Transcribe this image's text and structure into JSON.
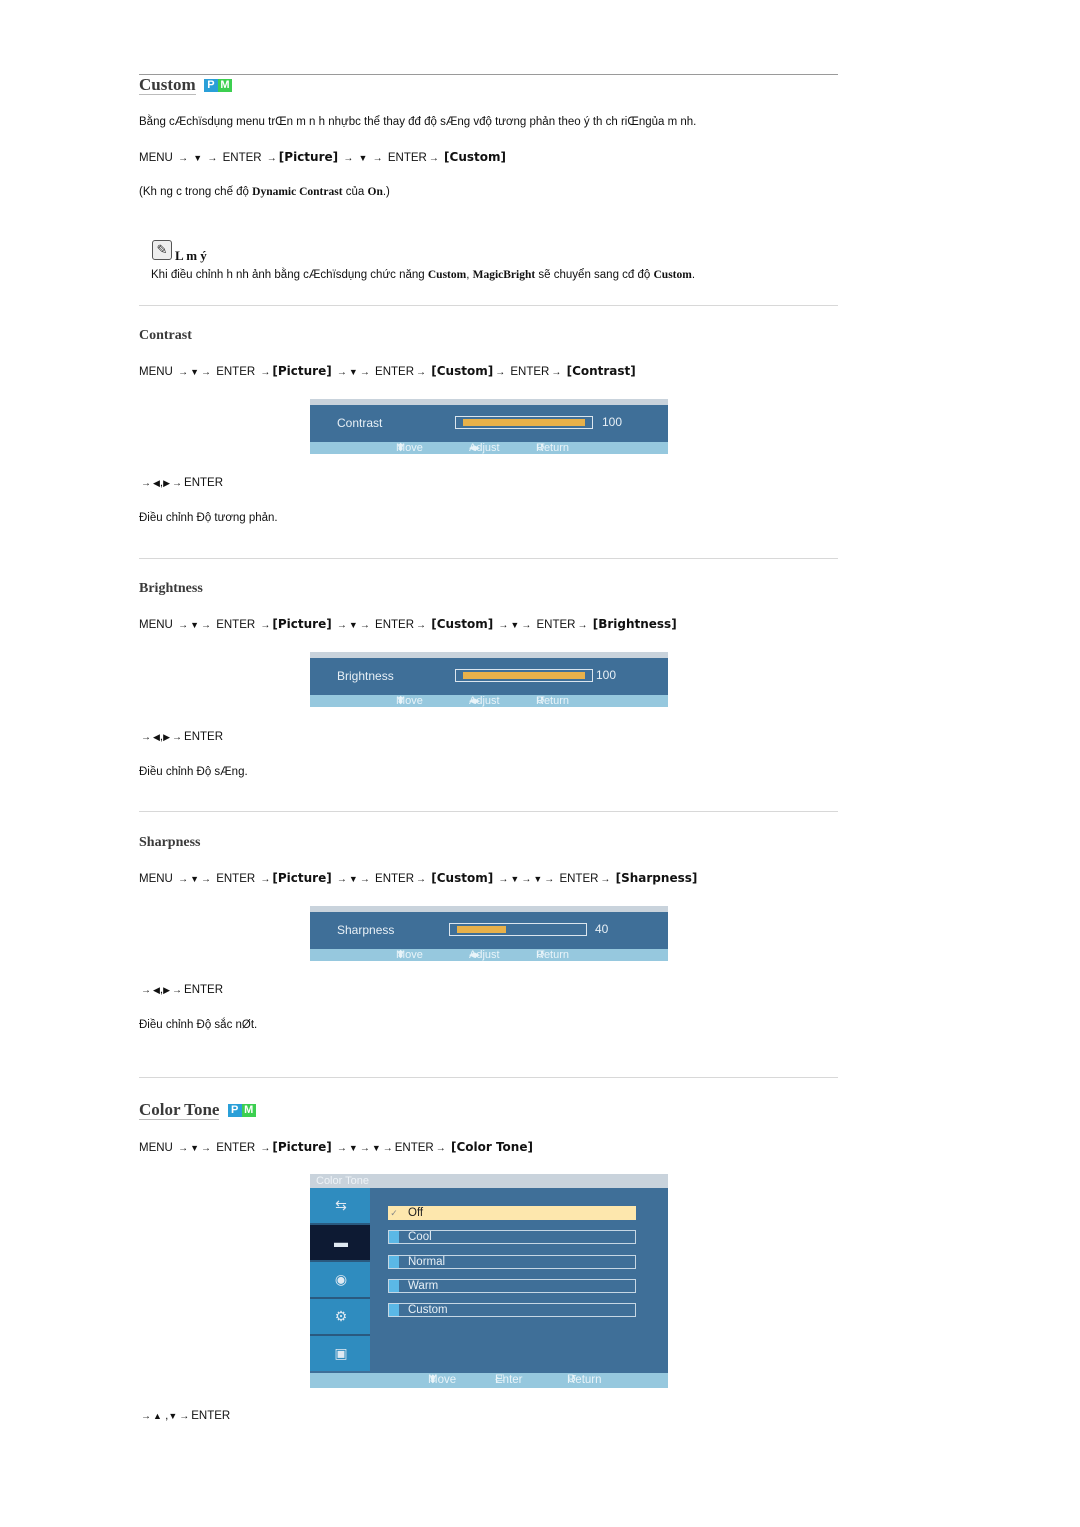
{
  "custom": {
    "title": "Custom",
    "badge_p": "P",
    "badge_m": "M",
    "desc": "Bằng cÆchïsdụng menu trŒn m n h nhựbc  thể thay đđ độ sÆng vđộ tương phản theo ý th ch riŒngủa m nh.",
    "path": {
      "menu": "MENU",
      "enter": "ENTER",
      "picture": "[Picture]",
      "custom": "[Custom]"
    },
    "note_line_prefix": "(Kh ng c  trong chế độ ",
    "note_line_bold1": "Dynamic Contrast",
    "note_line_mid": " của ",
    "note_line_bold2": "On",
    "note_line_suffix": ".)",
    "memo_title": "L m ý",
    "memo_prefix": "Khi điều chỉnh h nh ảnh bằng cÆchïsdụng chức năng ",
    "memo_bold1": "Custom",
    "memo_sep": ", ",
    "memo_bold2": "MagicBright",
    "memo_mid": " sẽ chuyển sang cđ độ ",
    "memo_bold3": "Custom",
    "memo_suffix": "."
  },
  "symbols": {
    "arrow": "→",
    "down": "▼",
    "up": "▲",
    "left": "◀",
    "right": "▶",
    "updown": "⬍",
    "leftright": "◂▸",
    "return": "↺",
    "enter_icon": "⏎",
    "check": "✓"
  },
  "contrast": {
    "title": "Contrast",
    "target": "[Contrast]",
    "osd_label": "Contrast",
    "value_text": "100",
    "value": 100,
    "adjust_line": "ENTER",
    "desc": "Điều chỉnh Độ tương phản."
  },
  "brightness": {
    "title": "Brightness",
    "target": "[Brightness]",
    "osd_label": "Brightness",
    "value_text": "100",
    "value": 100,
    "adjust_line": "ENTER",
    "desc": "Điều chỉnh Độ sÆng."
  },
  "sharpness": {
    "title": "Sharpness",
    "target": "[Sharpness]",
    "osd_label": "Sharpness",
    "value_text": "40",
    "value": 40,
    "adjust_line": "ENTER",
    "desc": "Điều chỉnh Độ sắc nØt."
  },
  "osd_footer": {
    "move": "Move",
    "adjust": "Adjust",
    "return": "Return",
    "enter": "Enter"
  },
  "color_tone": {
    "title": "Color Tone",
    "target": "[Color Tone]",
    "osd_title": "Color Tone",
    "options": [
      {
        "label": "Off",
        "selected": true
      },
      {
        "label": "Cool",
        "selected": false
      },
      {
        "label": "Normal",
        "selected": false
      },
      {
        "label": "Warm",
        "selected": false
      },
      {
        "label": "Custom",
        "selected": false
      }
    ],
    "side_tabs": [
      "input-icon",
      "picture-icon",
      "sound-icon",
      "setup-icon",
      "multi-window-icon"
    ],
    "selected_tab": 1,
    "nav_line": "ENTER"
  }
}
